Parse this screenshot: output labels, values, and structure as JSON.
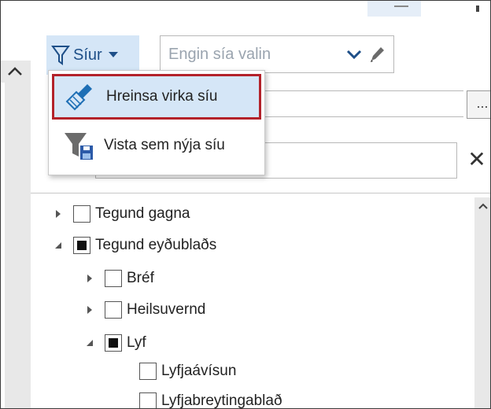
{
  "toolbar": {
    "filter_label": "Síur",
    "filter_select_placeholder": "Engin sía valin",
    "ellipsis_label": "...",
    "clear_symbol": "✕"
  },
  "filter_menu": {
    "items": [
      {
        "label": "Hreinsa virka síu",
        "icon": "broom-icon",
        "highlighted": true
      },
      {
        "label": "Vista sem nýja síu",
        "icon": "funnel-save-icon",
        "highlighted": false
      }
    ]
  },
  "tree": {
    "nodes": [
      {
        "label": "Tegund gagna",
        "expanded": false,
        "checked": "none"
      },
      {
        "label": "Tegund eyðublaðs",
        "expanded": true,
        "checked": "partial"
      },
      {
        "label": "Bréf",
        "expanded": false,
        "checked": "none"
      },
      {
        "label": "Heilsuvernd",
        "expanded": false,
        "checked": "none"
      },
      {
        "label": "Lyf",
        "expanded": true,
        "checked": "partial"
      },
      {
        "label": "Lyfjaávísun",
        "checked": "none"
      },
      {
        "label": "Lyfjabreytingablað",
        "checked": "none"
      }
    ]
  },
  "colors": {
    "accent_bg": "#d5e6f7",
    "highlight_border": "#b3222a",
    "filter_text": "#1e4f88"
  }
}
